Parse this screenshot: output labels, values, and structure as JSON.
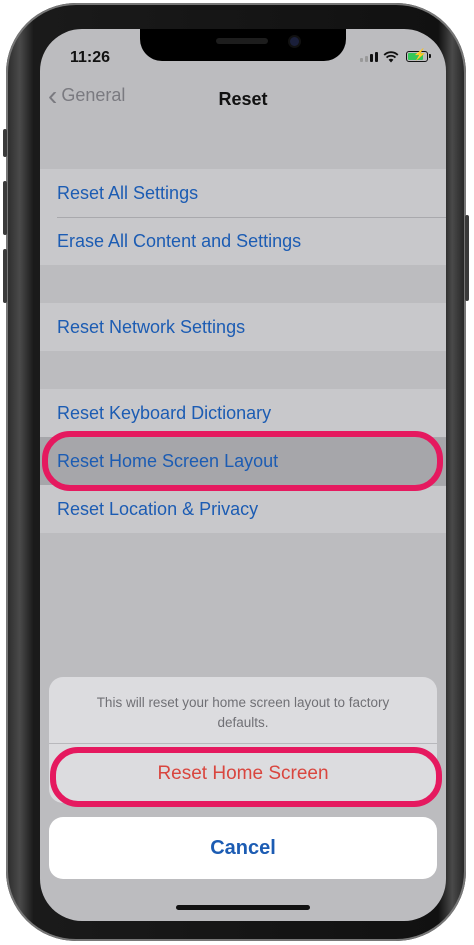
{
  "status_bar": {
    "time": "11:26"
  },
  "nav": {
    "back_label": "General",
    "title": "Reset"
  },
  "groups": [
    {
      "items": [
        {
          "label": "Reset All Settings"
        },
        {
          "label": "Erase All Content and Settings"
        }
      ]
    },
    {
      "items": [
        {
          "label": "Reset Network Settings"
        }
      ]
    },
    {
      "items": [
        {
          "label": "Reset Keyboard Dictionary"
        },
        {
          "label": "Reset Home Screen Layout"
        },
        {
          "label": "Reset Location & Privacy"
        }
      ]
    }
  ],
  "action_sheet": {
    "message": "This will reset your home screen layout to factory defaults.",
    "action_label": "Reset Home Screen",
    "cancel_label": "Cancel"
  },
  "colors": {
    "link_blue": "#1c5cb3",
    "destructive_red": "#d9463f",
    "highlight_pink": "#e5195f"
  },
  "icons": [
    "chevron-left-icon",
    "cellular-signal-icon",
    "wifi-icon",
    "battery-charging-icon"
  ]
}
